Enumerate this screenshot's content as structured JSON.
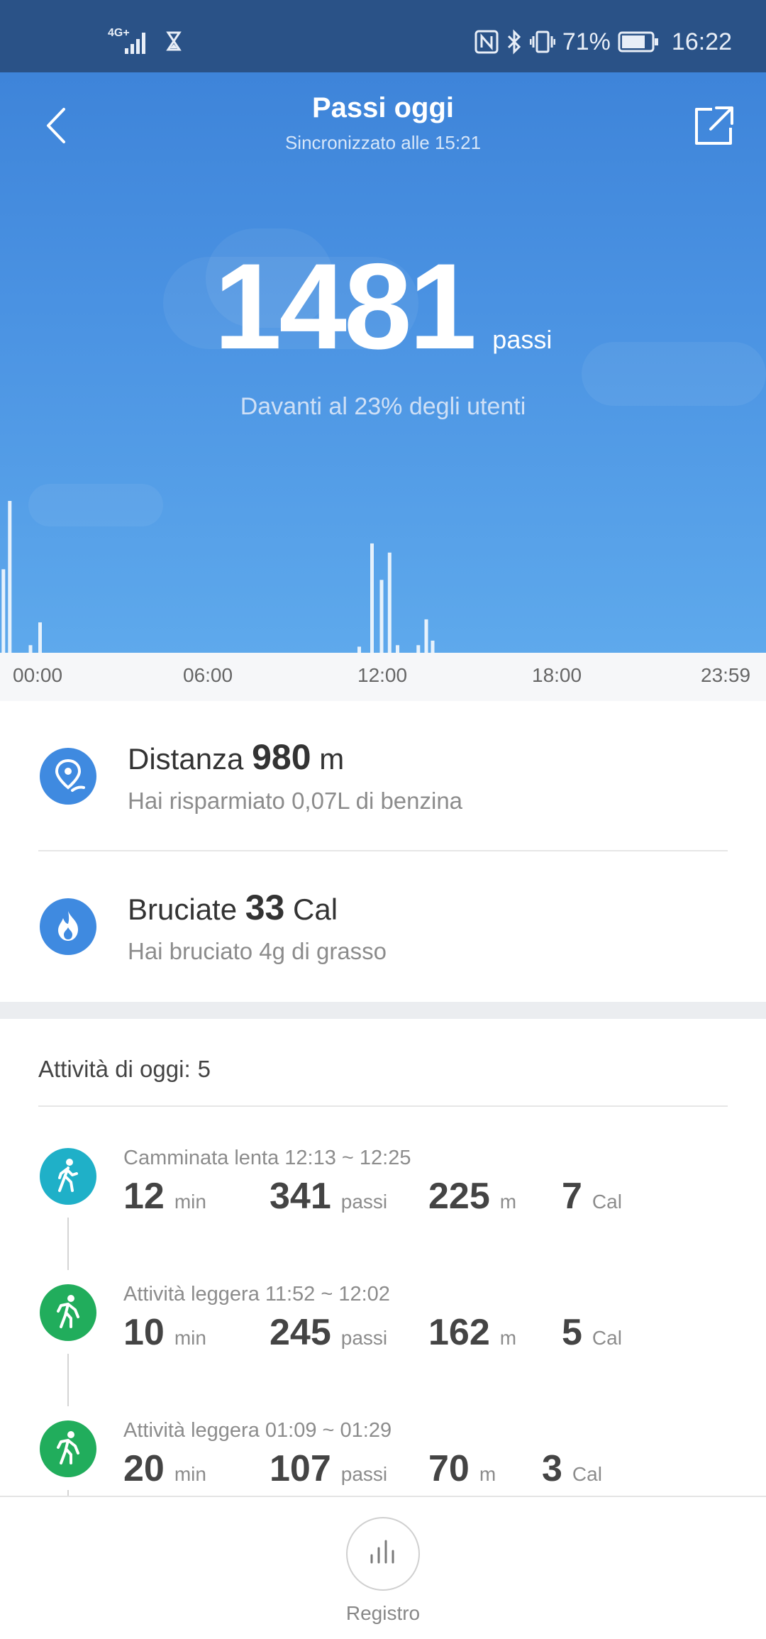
{
  "status_bar": {
    "network": "4G+",
    "battery": "71%",
    "time": "16:22",
    "icons": [
      "signal-icon",
      "hourglass-icon",
      "nfc-icon",
      "bluetooth-icon",
      "vibrate-icon",
      "battery-icon"
    ]
  },
  "header": {
    "title": "Passi oggi",
    "subtitle": "Sincronizzato alle 15:21",
    "back_icon": "back-arrow-icon",
    "share_icon": "share-icon"
  },
  "summary": {
    "steps": "1481",
    "steps_unit": "passi",
    "rank_text": "Davanti al 23% degli utenti"
  },
  "chart_data": {
    "type": "bar",
    "x_ticks": [
      "00:00",
      "06:00",
      "12:00",
      "18:00",
      "23:59"
    ],
    "bars": [
      {
        "hour": 0.05,
        "value": 55
      },
      {
        "hour": 0.25,
        "value": 100
      },
      {
        "hour": 0.9,
        "value": 5
      },
      {
        "hour": 1.2,
        "value": 20
      },
      {
        "hour": 11.2,
        "value": 4
      },
      {
        "hour": 11.6,
        "value": 72
      },
      {
        "hour": 11.9,
        "value": 48
      },
      {
        "hour": 12.15,
        "value": 66
      },
      {
        "hour": 12.4,
        "value": 5
      },
      {
        "hour": 13.05,
        "value": 5
      },
      {
        "hour": 13.3,
        "value": 22
      },
      {
        "hour": 13.5,
        "value": 8
      }
    ]
  },
  "distance": {
    "label": "Distanza",
    "value": "980",
    "unit": "m",
    "note": "Hai risparmiato 0,07L di benzina",
    "icon": "location-pin-icon",
    "icon_color": "#3f8ae0"
  },
  "calories": {
    "label": "Bruciate",
    "value": "33",
    "unit": "Cal",
    "note": "Hai bruciato 4g di grasso",
    "icon": "flame-icon",
    "icon_color": "#3f8ae0"
  },
  "activities": {
    "title": "Attività di oggi:",
    "count": "5",
    "items": [
      {
        "label": "Camminata lenta 12:13 ~ 12:25",
        "icon": "walking-icon",
        "color": "#1fb0c8",
        "minutes": "12",
        "min_unit": "min",
        "steps": "341",
        "steps_unit": "passi",
        "distance": "225",
        "distance_unit": "m",
        "cal": "7",
        "cal_unit": "Cal"
      },
      {
        "label": "Attività leggera 11:52 ~ 12:02",
        "icon": "light-activity-icon",
        "color": "#21ad5c",
        "minutes": "10",
        "min_unit": "min",
        "steps": "245",
        "steps_unit": "passi",
        "distance": "162",
        "distance_unit": "m",
        "cal": "5",
        "cal_unit": "Cal"
      },
      {
        "label": "Attività leggera 01:09 ~ 01:29",
        "icon": "light-activity-icon",
        "color": "#21ad5c",
        "minutes": "20",
        "min_unit": "min",
        "steps": "107",
        "steps_unit": "passi",
        "distance": "70",
        "distance_unit": "m",
        "cal": "3",
        "cal_unit": "Cal"
      }
    ]
  },
  "bottom_bar": {
    "button_label": "Registro",
    "icon": "bar-chart-icon"
  }
}
